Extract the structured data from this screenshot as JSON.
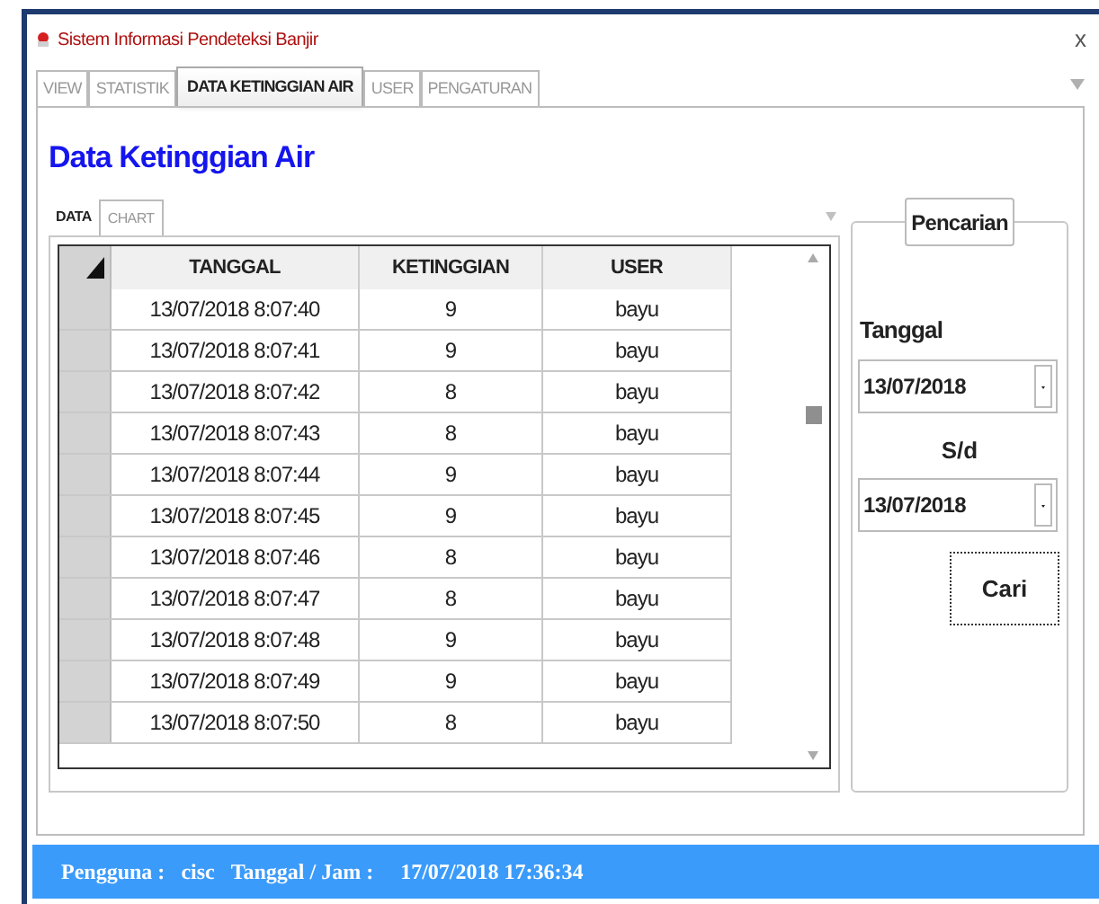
{
  "window": {
    "title": "Sistem Informasi Pendeteksi Banjir",
    "close": "x"
  },
  "tabs": [
    {
      "label": "VIEW",
      "selected": false
    },
    {
      "label": "STATISTIK",
      "selected": false
    },
    {
      "label": "DATA KETINGGIAN AIR",
      "selected": true
    },
    {
      "label": "USER",
      "selected": false
    },
    {
      "label": "PENGATURAN",
      "selected": false
    }
  ],
  "heading": "Data Ketinggian Air",
  "sub_tabs": [
    {
      "label": "DATA",
      "selected": true
    },
    {
      "label": "CHART",
      "selected": false
    }
  ],
  "table": {
    "columns": [
      "TANGGAL",
      "KETINGGIAN",
      "USER"
    ],
    "rows": [
      [
        "13/07/2018 8:07:40",
        "9",
        "bayu"
      ],
      [
        "13/07/2018 8:07:41",
        "9",
        "bayu"
      ],
      [
        "13/07/2018 8:07:42",
        "8",
        "bayu"
      ],
      [
        "13/07/2018 8:07:43",
        "8",
        "bayu"
      ],
      [
        "13/07/2018 8:07:44",
        "9",
        "bayu"
      ],
      [
        "13/07/2018 8:07:45",
        "9",
        "bayu"
      ],
      [
        "13/07/2018 8:07:46",
        "8",
        "bayu"
      ],
      [
        "13/07/2018 8:07:47",
        "8",
        "bayu"
      ],
      [
        "13/07/2018 8:07:48",
        "9",
        "bayu"
      ],
      [
        "13/07/2018 8:07:49",
        "9",
        "bayu"
      ],
      [
        "13/07/2018 8:07:50",
        "8",
        "bayu"
      ]
    ]
  },
  "search": {
    "title": "Pencarian",
    "from_label": "Tanggal",
    "from": "13/07/2018",
    "to_label": "S/d",
    "to": "13/07/2018",
    "button": "Cari"
  },
  "status_bar": {
    "user_label": "Pengguna :",
    "user": "cisc",
    "time_label": "Tanggal / Jam :",
    "time": "17/07/2018 17:36:34"
  }
}
